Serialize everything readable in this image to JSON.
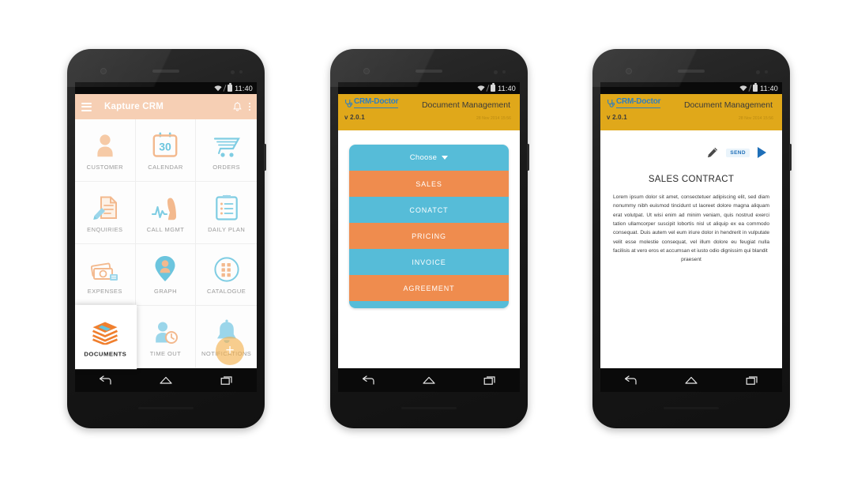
{
  "status_bar": {
    "time": "11:40",
    "wifi_icon": "wifi-icon",
    "battery_icon": "battery-icon"
  },
  "nav_bar": {
    "back": "back-icon",
    "home": "home-icon",
    "recents": "recents-icon"
  },
  "phone1": {
    "appbar": {
      "menu_icon": "hamburger-icon",
      "title": "Kapture CRM",
      "notification_icon": "bell-icon",
      "overflow_icon": "kebab-menu-icon"
    },
    "tiles": [
      {
        "label": "CUSTOMER",
        "icon": "customer-icon",
        "active": false
      },
      {
        "label": "CALENDAR",
        "icon": "calendar-icon",
        "active": false
      },
      {
        "label": "ORDERS",
        "icon": "orders-cart-icon",
        "active": false
      },
      {
        "label": "ENQUIRIES",
        "icon": "enquiries-icon",
        "active": false
      },
      {
        "label": "CALL MGMT",
        "icon": "call-mgmt-icon",
        "active": false
      },
      {
        "label": "DAILY PLAN",
        "icon": "daily-plan-icon",
        "active": false
      },
      {
        "label": "EXPENSES",
        "icon": "expenses-icon",
        "active": false
      },
      {
        "label": "GRAPH",
        "icon": "graph-pin-icon",
        "active": false
      },
      {
        "label": "CATALOGUE",
        "icon": "catalogue-icon",
        "active": false
      },
      {
        "label": "DOCUMENTS",
        "icon": "documents-books-icon",
        "active": true
      },
      {
        "label": "TIME OUT",
        "icon": "time-out-icon",
        "active": false
      },
      {
        "label": "NOTIFICATIONS",
        "icon": "notifications-bell-icon",
        "active": false
      }
    ],
    "fab": {
      "label": "+",
      "icon": "add-fab-icon"
    },
    "calendar_day": "30"
  },
  "phone2": {
    "header": {
      "brand": "CRM-Doctor",
      "brand_icon": "stethoscope-icon",
      "title": "Document Management",
      "version": "v 2.0.1",
      "date": "28 Nov 2014 15:56"
    },
    "menu": {
      "header_label": "Choose",
      "caret_icon": "chevron-down-icon",
      "items": [
        {
          "label": "SALES",
          "color": "orange"
        },
        {
          "label": "CONATCT",
          "color": "blue"
        },
        {
          "label": "PRICING",
          "color": "orange"
        },
        {
          "label": "INVOICE",
          "color": "blue"
        },
        {
          "label": "AGREEMENT",
          "color": "orange"
        }
      ]
    }
  },
  "phone3": {
    "header": {
      "brand": "CRM-Doctor",
      "brand_icon": "stethoscope-icon",
      "title": "Document Management",
      "version": "v 2.0.1",
      "date": "28 Nov 2014 15:56"
    },
    "actions": {
      "edit_icon": "pencil-edit-icon",
      "send_label": "SEND",
      "play_icon": "send-play-icon"
    },
    "document": {
      "heading": "SALES CONTRACT",
      "body": "Lorem ipsum dolor sit amet, consectetuer adipiscing elit, sed diam nonummy nibh euismod tincidunt ut laoreet dolore magna aliquam erat volutpat. Ut wisi enim ad minim veniam, quis nostrud exerci tation ullamcorper suscipit lobortis nisl ut aliquip ex ea commodo consequat. Duis autem vel eum iriure dolor in hendrerit in vulputate velit esse molestie consequat, vel illum dolore eu feugiat nulla facilisis at vero eros et accumsan et iusto odio dignissim qui blandit",
      "body_last_line": "praesent"
    }
  },
  "colors": {
    "appbar_peach": "#f6cfb4",
    "header_gold": "#e0a81a",
    "accent_orange": "#ef8c4e",
    "accent_blue": "#56bcd8",
    "brand_blue": "#2e7fc2",
    "fab_orange": "#f3b04a"
  }
}
